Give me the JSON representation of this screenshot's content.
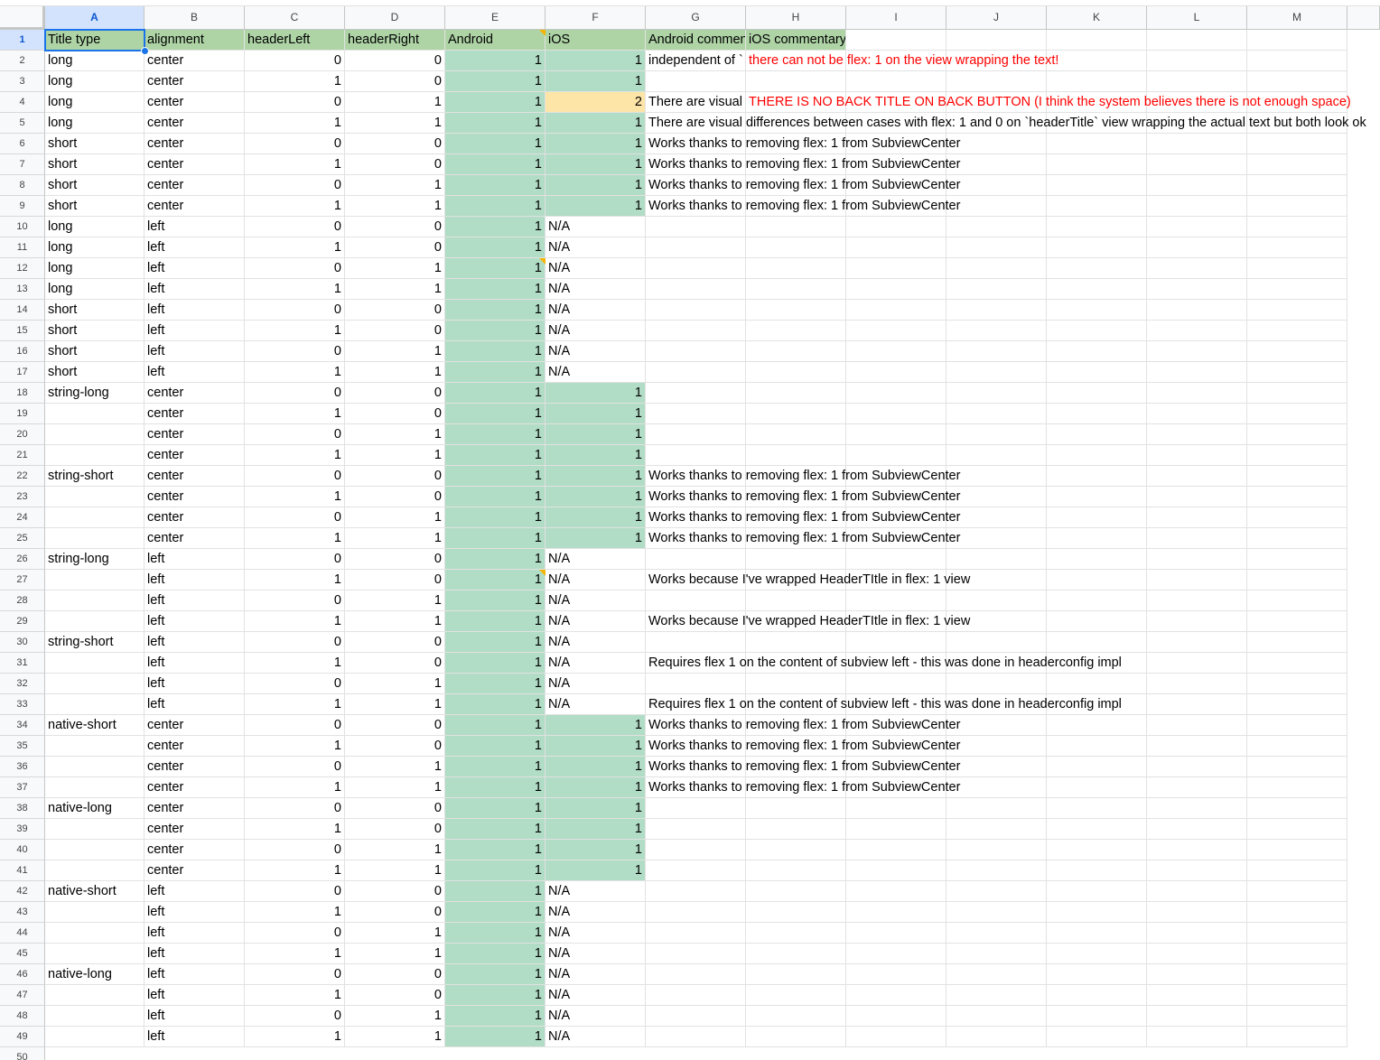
{
  "columns": [
    "A",
    "B",
    "C",
    "D",
    "E",
    "F",
    "G",
    "H",
    "I",
    "J",
    "K",
    "L",
    "M"
  ],
  "selected_column": "A",
  "selected_row": "1",
  "colors": {
    "header_green": "#aed4a6",
    "green_cell": "#b1dcc5",
    "yellow_cell": "#fde4a7",
    "note_marker": "#f4b400",
    "selection": "#1a73e8",
    "red_text": "#ff0000"
  },
  "header_row": [
    "Title type",
    "alignment",
    "headerLeft",
    "headerRight",
    "Android",
    "iOS",
    "Android commentary",
    "iOS commentary"
  ],
  "rows": [
    {
      "n": "2",
      "a": "long",
      "b": "center",
      "c": "0",
      "d": "0",
      "e": "1",
      "f": "1",
      "g": "independent of `",
      "h": "there can not be flex: 1 on the view wrapping the text!"
    },
    {
      "n": "3",
      "a": "long",
      "b": "center",
      "c": "1",
      "d": "0",
      "e": "1",
      "f": "1",
      "g": "",
      "h": ""
    },
    {
      "n": "4",
      "a": "long",
      "b": "center",
      "c": "0",
      "d": "1",
      "e": "1",
      "f": "2",
      "g": "There are visual",
      "h": "THERE IS NO BACK TITLE ON BACK BUTTON (I think the system believes there is not enough space)"
    },
    {
      "n": "5",
      "a": "long",
      "b": "center",
      "c": "1",
      "d": "1",
      "e": "1",
      "f": "1",
      "g": "There are visual differences between cases with flex: 1 and 0 on `headerTitle` view wrapping the actual text but both look ok",
      "h": ""
    },
    {
      "n": "6",
      "a": "short",
      "b": "center",
      "c": "0",
      "d": "0",
      "e": "1",
      "f": "1",
      "g": "Works thanks to removing flex: 1 from SubviewCenter",
      "h": ""
    },
    {
      "n": "7",
      "a": "short",
      "b": "center",
      "c": "1",
      "d": "0",
      "e": "1",
      "f": "1",
      "g": "Works thanks to removing flex: 1 from SubviewCenter",
      "h": ""
    },
    {
      "n": "8",
      "a": "short",
      "b": "center",
      "c": "0",
      "d": "1",
      "e": "1",
      "f": "1",
      "g": "Works thanks to removing flex: 1 from SubviewCenter",
      "h": ""
    },
    {
      "n": "9",
      "a": "short",
      "b": "center",
      "c": "1",
      "d": "1",
      "e": "1",
      "f": "1",
      "g": "Works thanks to removing flex: 1 from SubviewCenter",
      "h": ""
    },
    {
      "n": "10",
      "a": "long",
      "b": "left",
      "c": "0",
      "d": "0",
      "e": "1",
      "f": "N/A",
      "g": "",
      "h": ""
    },
    {
      "n": "11",
      "a": "long",
      "b": "left",
      "c": "1",
      "d": "0",
      "e": "1",
      "f": "N/A",
      "g": "",
      "h": ""
    },
    {
      "n": "12",
      "a": "long",
      "b": "left",
      "c": "0",
      "d": "1",
      "e": "1",
      "f": "N/A",
      "g": "",
      "h": ""
    },
    {
      "n": "13",
      "a": "long",
      "b": "left",
      "c": "1",
      "d": "1",
      "e": "1",
      "f": "N/A",
      "g": "",
      "h": ""
    },
    {
      "n": "14",
      "a": "short",
      "b": "left",
      "c": "0",
      "d": "0",
      "e": "1",
      "f": "N/A",
      "g": "",
      "h": ""
    },
    {
      "n": "15",
      "a": "short",
      "b": "left",
      "c": "1",
      "d": "0",
      "e": "1",
      "f": "N/A",
      "g": "",
      "h": ""
    },
    {
      "n": "16",
      "a": "short",
      "b": "left",
      "c": "0",
      "d": "1",
      "e": "1",
      "f": "N/A",
      "g": "",
      "h": ""
    },
    {
      "n": "17",
      "a": "short",
      "b": "left",
      "c": "1",
      "d": "1",
      "e": "1",
      "f": "N/A",
      "g": "",
      "h": ""
    },
    {
      "n": "18",
      "a": "string-long",
      "b": "center",
      "c": "0",
      "d": "0",
      "e": "1",
      "f": "1",
      "g": "",
      "h": ""
    },
    {
      "n": "19",
      "a": "",
      "b": "center",
      "c": "1",
      "d": "0",
      "e": "1",
      "f": "1",
      "g": "",
      "h": ""
    },
    {
      "n": "20",
      "a": "",
      "b": "center",
      "c": "0",
      "d": "1",
      "e": "1",
      "f": "1",
      "g": "",
      "h": ""
    },
    {
      "n": "21",
      "a": "",
      "b": "center",
      "c": "1",
      "d": "1",
      "e": "1",
      "f": "1",
      "g": "",
      "h": ""
    },
    {
      "n": "22",
      "a": "string-short",
      "b": "center",
      "c": "0",
      "d": "0",
      "e": "1",
      "f": "1",
      "g": "Works thanks to removing flex: 1 from SubviewCenter",
      "h": ""
    },
    {
      "n": "23",
      "a": "",
      "b": "center",
      "c": "1",
      "d": "0",
      "e": "1",
      "f": "1",
      "g": "Works thanks to removing flex: 1 from SubviewCenter",
      "h": ""
    },
    {
      "n": "24",
      "a": "",
      "b": "center",
      "c": "0",
      "d": "1",
      "e": "1",
      "f": "1",
      "g": "Works thanks to removing flex: 1 from SubviewCenter",
      "h": ""
    },
    {
      "n": "25",
      "a": "",
      "b": "center",
      "c": "1",
      "d": "1",
      "e": "1",
      "f": "1",
      "g": "Works thanks to removing flex: 1 from SubviewCenter",
      "h": ""
    },
    {
      "n": "26",
      "a": "string-long",
      "b": "left",
      "c": "0",
      "d": "0",
      "e": "1",
      "f": "N/A",
      "g": "",
      "h": ""
    },
    {
      "n": "27",
      "a": "",
      "b": "left",
      "c": "1",
      "d": "0",
      "e": "1",
      "f": "N/A",
      "g": "Works because I've wrapped HeaderTItle in flex: 1 view",
      "h": ""
    },
    {
      "n": "28",
      "a": "",
      "b": "left",
      "c": "0",
      "d": "1",
      "e": "1",
      "f": "N/A",
      "g": "",
      "h": ""
    },
    {
      "n": "29",
      "a": "",
      "b": "left",
      "c": "1",
      "d": "1",
      "e": "1",
      "f": "N/A",
      "g": "Works because I've wrapped HeaderTItle in flex: 1 view",
      "h": ""
    },
    {
      "n": "30",
      "a": "string-short",
      "b": "left",
      "c": "0",
      "d": "0",
      "e": "1",
      "f": "N/A",
      "g": "",
      "h": ""
    },
    {
      "n": "31",
      "a": "",
      "b": "left",
      "c": "1",
      "d": "0",
      "e": "1",
      "f": "N/A",
      "g": "Requires flex 1 on the content of subview left - this was done in headerconfig impl",
      "h": ""
    },
    {
      "n": "32",
      "a": "",
      "b": "left",
      "c": "0",
      "d": "1",
      "e": "1",
      "f": "N/A",
      "g": "",
      "h": ""
    },
    {
      "n": "33",
      "a": "",
      "b": "left",
      "c": "1",
      "d": "1",
      "e": "1",
      "f": "N/A",
      "g": "Requires flex 1 on the content of subview left - this was done in headerconfig impl",
      "h": ""
    },
    {
      "n": "34",
      "a": "native-short",
      "b": "center",
      "c": "0",
      "d": "0",
      "e": "1",
      "f": "1",
      "g": "Works thanks to removing flex: 1 from SubviewCenter",
      "h": ""
    },
    {
      "n": "35",
      "a": "",
      "b": "center",
      "c": "1",
      "d": "0",
      "e": "1",
      "f": "1",
      "g": "Works thanks to removing flex: 1 from SubviewCenter",
      "h": ""
    },
    {
      "n": "36",
      "a": "",
      "b": "center",
      "c": "0",
      "d": "1",
      "e": "1",
      "f": "1",
      "g": "Works thanks to removing flex: 1 from SubviewCenter",
      "h": ""
    },
    {
      "n": "37",
      "a": "",
      "b": "center",
      "c": "1",
      "d": "1",
      "e": "1",
      "f": "1",
      "g": "Works thanks to removing flex: 1 from SubviewCenter",
      "h": ""
    },
    {
      "n": "38",
      "a": "native-long",
      "b": "center",
      "c": "0",
      "d": "0",
      "e": "1",
      "f": "1",
      "g": "",
      "h": ""
    },
    {
      "n": "39",
      "a": "",
      "b": "center",
      "c": "1",
      "d": "0",
      "e": "1",
      "f": "1",
      "g": "",
      "h": ""
    },
    {
      "n": "40",
      "a": "",
      "b": "center",
      "c": "0",
      "d": "1",
      "e": "1",
      "f": "1",
      "g": "",
      "h": ""
    },
    {
      "n": "41",
      "a": "",
      "b": "center",
      "c": "1",
      "d": "1",
      "e": "1",
      "f": "1",
      "g": "",
      "h": ""
    },
    {
      "n": "42",
      "a": "native-short",
      "b": "left",
      "c": "0",
      "d": "0",
      "e": "1",
      "f": "N/A",
      "g": "",
      "h": ""
    },
    {
      "n": "43",
      "a": "",
      "b": "left",
      "c": "1",
      "d": "0",
      "e": "1",
      "f": "N/A",
      "g": "",
      "h": ""
    },
    {
      "n": "44",
      "a": "",
      "b": "left",
      "c": "0",
      "d": "1",
      "e": "1",
      "f": "N/A",
      "g": "",
      "h": ""
    },
    {
      "n": "45",
      "a": "",
      "b": "left",
      "c": "1",
      "d": "1",
      "e": "1",
      "f": "N/A",
      "g": "",
      "h": ""
    },
    {
      "n": "46",
      "a": "native-long",
      "b": "left",
      "c": "0",
      "d": "0",
      "e": "1",
      "f": "N/A",
      "g": "",
      "h": ""
    },
    {
      "n": "47",
      "a": "",
      "b": "left",
      "c": "1",
      "d": "0",
      "e": "1",
      "f": "N/A",
      "g": "",
      "h": ""
    },
    {
      "n": "48",
      "a": "",
      "b": "left",
      "c": "0",
      "d": "1",
      "e": "1",
      "f": "N/A",
      "g": "",
      "h": ""
    },
    {
      "n": "49",
      "a": "",
      "b": "left",
      "c": "1",
      "d": "1",
      "e": "1",
      "f": "N/A",
      "g": "",
      "h": ""
    }
  ],
  "last_row_number": "50"
}
